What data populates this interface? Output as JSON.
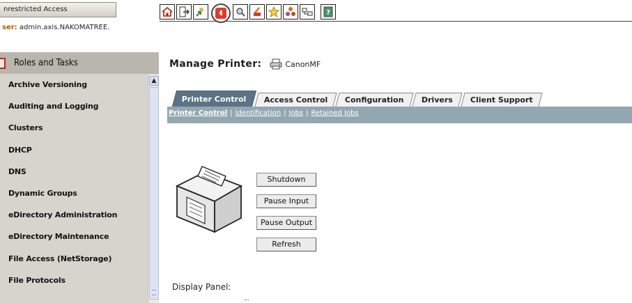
{
  "header": {
    "access_label": "nrestricted Access",
    "user_key": "ser:",
    "user_value": "admin.axis.NAKOMATREE."
  },
  "toolbar": {
    "icons": [
      "home-icon",
      "exit-icon",
      "refresh-icon",
      "stop-icon",
      "search-icon",
      "pencil-icon",
      "favorite-icon",
      "objects-icon",
      "config-icon",
      "help-icon"
    ]
  },
  "sidebar": {
    "title": "Roles and Tasks",
    "items": [
      {
        "label": "Archive Versioning"
      },
      {
        "label": "Auditing and Logging"
      },
      {
        "label": "Clusters"
      },
      {
        "label": "DHCP"
      },
      {
        "label": "DNS"
      },
      {
        "label": "Dynamic Groups"
      },
      {
        "label": "eDirectory Administration"
      },
      {
        "label": "eDirectory Maintenance"
      },
      {
        "label": "File Access (NetStorage)"
      },
      {
        "label": "File Protocols"
      }
    ]
  },
  "main": {
    "title": "Manage Printer:",
    "printer_name": "CanonMF",
    "tabs": [
      {
        "label": "Printer Control",
        "active": true
      },
      {
        "label": "Access Control",
        "active": false
      },
      {
        "label": "Configuration",
        "active": false
      },
      {
        "label": "Drivers",
        "active": false
      },
      {
        "label": "Client Support",
        "active": false
      }
    ],
    "subnav": [
      {
        "label": "Printer Control"
      },
      {
        "label": "Identification"
      },
      {
        "label": "Jobs"
      },
      {
        "label": "Retained Jobs"
      }
    ],
    "buttons": {
      "shutdown": "Shutdown",
      "pause_input": "Pause Input",
      "pause_output": "Pause Output",
      "refresh": "Refresh"
    },
    "display_panel_label": "Display Panel:"
  },
  "colors": {
    "active_tab": "#5b7384",
    "subnav_bar": "#93a7b1",
    "sidebar_bg": "#d6d4cd"
  }
}
